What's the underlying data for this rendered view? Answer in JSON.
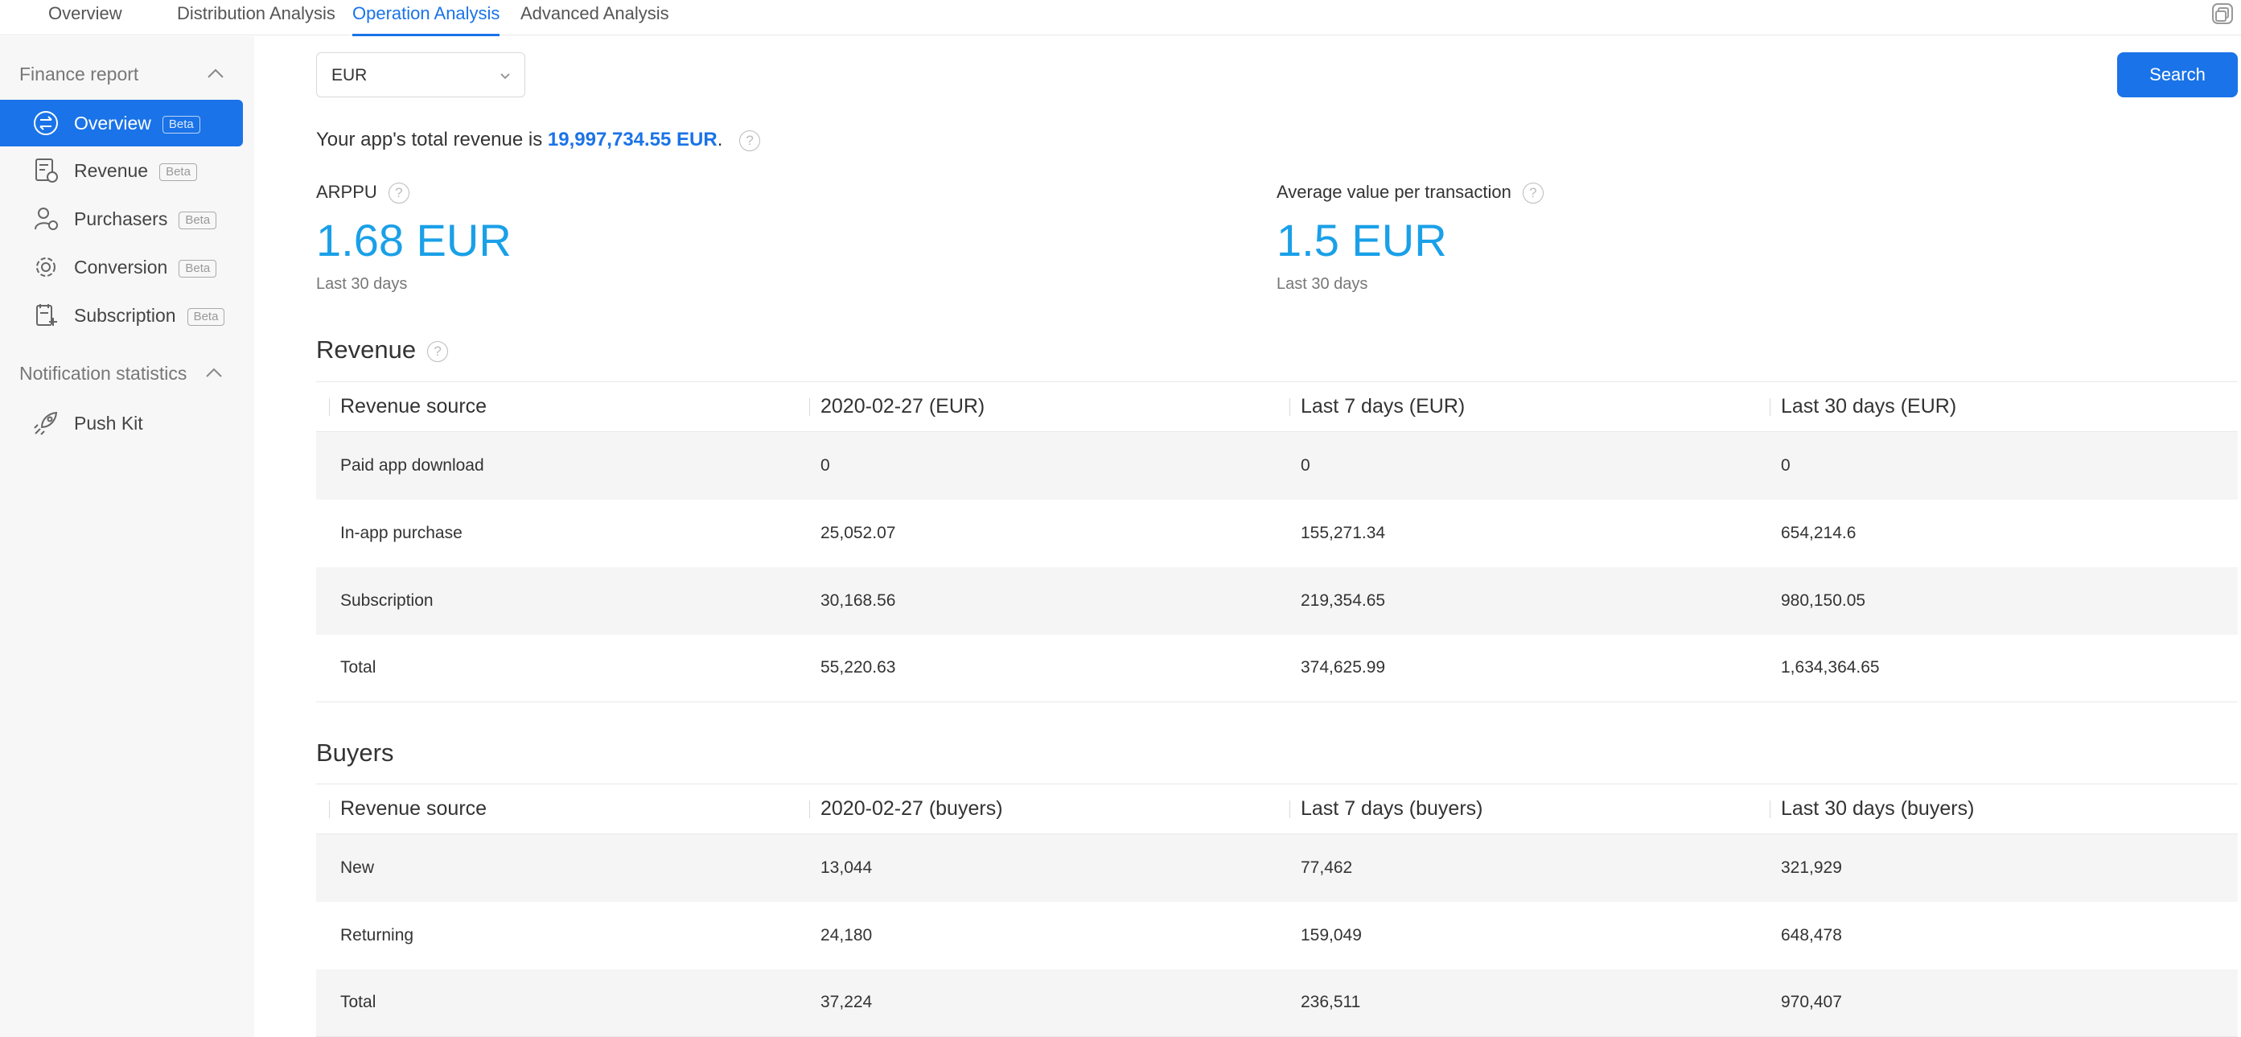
{
  "topnav": {
    "tabs": [
      {
        "label": "Overview"
      },
      {
        "label": "Distribution Analysis"
      },
      {
        "label": "Operation Analysis",
        "active": true
      },
      {
        "label": "Advanced Analysis"
      }
    ],
    "corner_icon": "window-restore-icon"
  },
  "sidebar": {
    "groups": [
      {
        "label": "Finance report"
      },
      {
        "label": "Notification statistics"
      }
    ],
    "items": [
      {
        "label": "Overview",
        "badge": "Beta",
        "icon": "exchange-icon",
        "active": true
      },
      {
        "label": "Revenue",
        "badge": "Beta",
        "icon": "revenue-doc-icon"
      },
      {
        "label": "Purchasers",
        "badge": "Beta",
        "icon": "purchaser-icon"
      },
      {
        "label": "Conversion",
        "badge": "Beta",
        "icon": "conversion-icon"
      },
      {
        "label": "Subscription",
        "badge": "Beta",
        "icon": "subscription-icon"
      },
      {
        "label": "Push Kit",
        "icon": "rocket-icon"
      }
    ]
  },
  "filters": {
    "currency": "EUR",
    "search_label": "Search"
  },
  "summary": {
    "prefix": "Your app's total revenue is ",
    "amount": "19,997,734.55 EUR",
    "suffix": "."
  },
  "metrics": [
    {
      "label": "ARPPU",
      "value": "1.68 EUR",
      "period": "Last 30 days"
    },
    {
      "label": "Average value per transaction",
      "value": "1.5 EUR",
      "period": "Last 30 days"
    }
  ],
  "revenue": {
    "title": "Revenue",
    "headers": [
      "Revenue source",
      "2020-02-27 (EUR)",
      "Last 7 days (EUR)",
      "Last 30 days (EUR)"
    ],
    "rows": [
      [
        "Paid app download",
        "0",
        "0",
        "0"
      ],
      [
        "In-app purchase",
        "25,052.07",
        "155,271.34",
        "654,214.6"
      ],
      [
        "Subscription",
        "30,168.56",
        "219,354.65",
        "980,150.05"
      ],
      [
        "Total",
        "55,220.63",
        "374,625.99",
        "1,634,364.65"
      ]
    ]
  },
  "buyers": {
    "title": "Buyers",
    "headers": [
      "Revenue source",
      "2020-02-27 (buyers)",
      "Last 7 days (buyers)",
      "Last 30 days (buyers)"
    ],
    "rows": [
      [
        "New",
        "13,044",
        "77,462",
        "321,929"
      ],
      [
        "Returning",
        "24,180",
        "159,049",
        "648,478"
      ],
      [
        "Total",
        "37,224",
        "236,511",
        "970,407"
      ]
    ]
  },
  "colors": {
    "accent": "#1a73e8",
    "metric_value": "#1aa0e8",
    "sidebar_bg": "#f7f7f7",
    "row_shade": "#f5f5f5"
  }
}
